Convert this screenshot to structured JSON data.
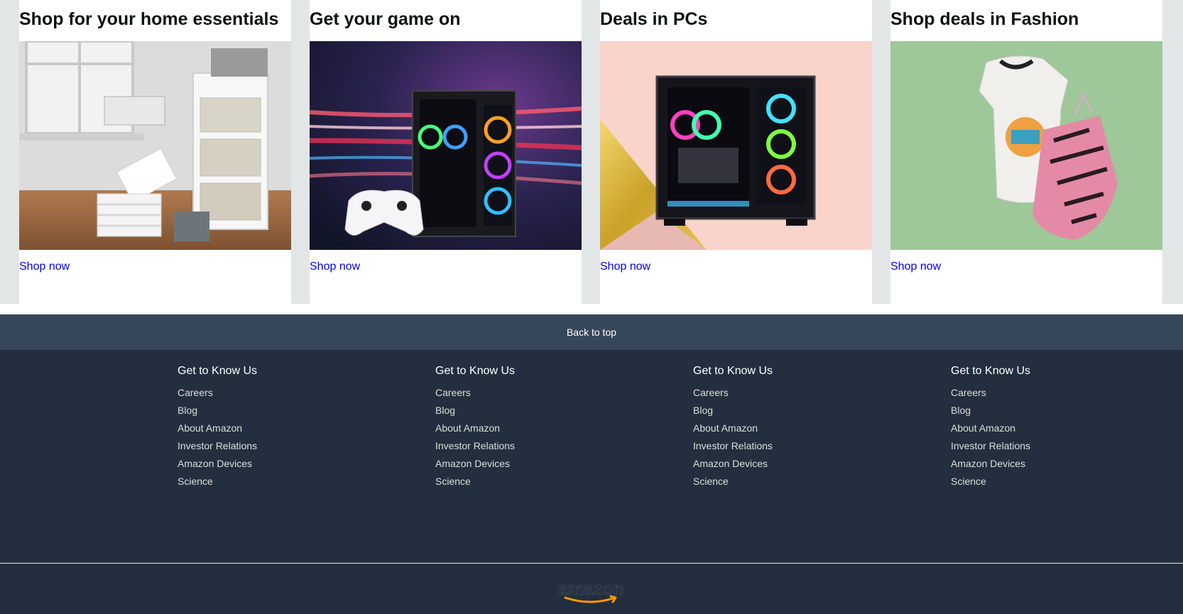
{
  "cards": [
    {
      "title": "Shop for your home essentials",
      "link": "Shop now",
      "image": "home-storage-image"
    },
    {
      "title": "Get your game on",
      "link": "Shop now",
      "image": "gaming-pc-image"
    },
    {
      "title": "Deals in PCs",
      "link": "Shop now",
      "image": "desktop-pc-image"
    },
    {
      "title": "Shop deals in Fashion",
      "link": "Shop now",
      "image": "fashion-clothes-image"
    }
  ],
  "back_to_top": "Back to top",
  "footer": {
    "columns": [
      {
        "heading": "Get to Know Us",
        "links": [
          "Careers",
          "Blog",
          "About Amazon",
          "Investor Relations",
          "Amazon Devices",
          "Science"
        ]
      },
      {
        "heading": "Get to Know Us",
        "links": [
          "Careers",
          "Blog",
          "About Amazon",
          "Investor Relations",
          "Amazon Devices",
          "Science"
        ]
      },
      {
        "heading": "Get to Know Us",
        "links": [
          "Careers",
          "Blog",
          "About Amazon",
          "Investor Relations",
          "Amazon Devices",
          "Science"
        ]
      },
      {
        "heading": "Get to Know Us",
        "links": [
          "Careers",
          "Blog",
          "About Amazon",
          "Investor Relations",
          "Amazon Devices",
          "Science"
        ]
      }
    ],
    "logo_text": "amazon"
  },
  "colors": {
    "link": "#0000ee",
    "back_to_top_bg": "#37475a",
    "footer_bg": "#232f3e",
    "logo_smile": "#ff9900"
  }
}
